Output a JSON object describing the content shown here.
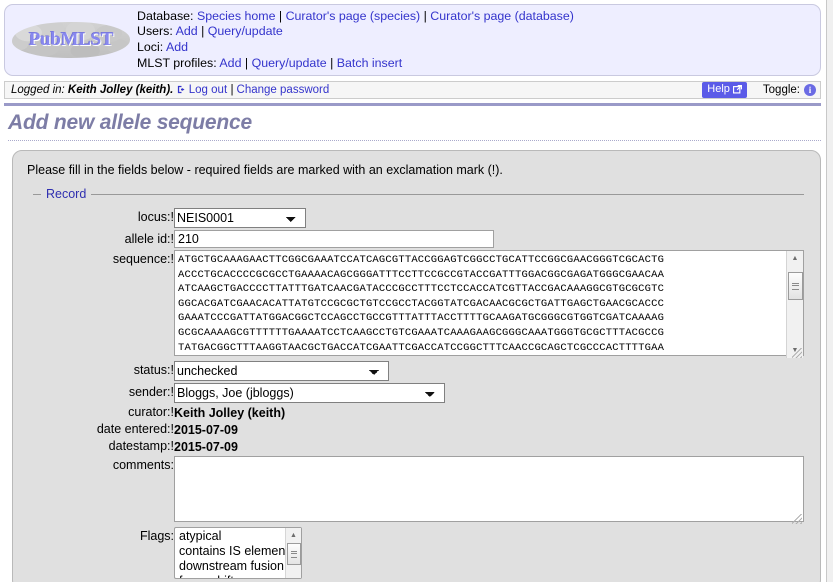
{
  "header": {
    "logo_text": "PubMLST",
    "nav": [
      {
        "label": "Database:",
        "links": [
          "Species home",
          "Curator's page (species)",
          "Curator's page (database)"
        ]
      },
      {
        "label": "Users:",
        "links": [
          "Add",
          "Query/update"
        ]
      },
      {
        "label": "Loci:",
        "links": [
          "Add"
        ]
      },
      {
        "label": "MLST profiles:",
        "links": [
          "Add",
          "Query/update",
          "Batch insert"
        ]
      }
    ]
  },
  "login_bar": {
    "prefix": "Logged in:",
    "user": "Keith Jolley (keith).",
    "logout": "Log out",
    "separator": "|",
    "change_password": "Change password",
    "help_label": "Help",
    "help_icon": "external-link-icon",
    "toggle_label": "Toggle:",
    "toggle_icon": "info-icon",
    "help_button_color": "#5b5be8"
  },
  "page": {
    "title": "Add new allele sequence",
    "title_color": "#7d7da6",
    "intro": "Please fill in the fields below - required fields are marked with an exclamation mark (!)."
  },
  "record": {
    "legend": "Record",
    "legend_color": "#2f2fb0",
    "fields": {
      "locus": {
        "label": "locus:!",
        "value": "NEIS0001",
        "options": [
          "NEIS0001"
        ]
      },
      "allele_id": {
        "label": "allele id:!",
        "value": "210",
        "placeholder": ""
      },
      "sequence": {
        "label": "sequence:!",
        "value": "ATGCTGCAAAGAACTTCGGCGAAATCCATCAGCGTTACCGGAGTCGGCCTGCATTCCGGCGAACGGGTCGCACTG\nACCCTGCACCCCGCGCCTGAAAACAGCGGGATTTCCTTCCGCCGTACCGATTTGGACGGCGAGATGGGCGAACAA\nATCAAGCTGACCCCTTATTTGATCAACGATACCCGCCTTTCCTCCACCATCGTTACCGACAAAGGCGTGCGCGTC\nGGCACGATCGAACACATTATGTCCGCGCTGTCCGCCTACGGTATCGACAACGCGCTGATTGAGCTGAACGCACCC\nGAAATCCCGATTATGGACGGCTCCAGCCTGCCGTTTATTTACCTTTTGCAAGATGCGGGCGTGGTCGATCAAAAG\nGCGCAAAAGCGTTTTTTGAAAATCCTCAAGCCTGTCGAAATCAAAGAAGCGGGCAAATGGGTGCGCTTTACGCCG\nTATGACGGCTTTAAGGTAACGCTGACCATCGAATTCGACCATCCGGCTTTCAACCGCAGCTCGCCCACTTTTGAA",
        "scrollbar": "vertical-scrollbar"
      },
      "status": {
        "label": "status:!",
        "value": "unchecked",
        "options": [
          "unchecked"
        ]
      },
      "sender": {
        "label": "sender:!",
        "value": "Bloggs, Joe (jbloggs)",
        "options": [
          "Bloggs, Joe (jbloggs)"
        ]
      },
      "curator": {
        "label": "curator:!",
        "value": "Keith Jolley (keith)"
      },
      "date_entered": {
        "label": "date entered:!",
        "value": "2015-07-09"
      },
      "datestamp": {
        "label": "datestamp:!",
        "value": "2015-07-09"
      },
      "comments": {
        "label": "comments:",
        "value": "",
        "placeholder": ""
      },
      "flags": {
        "label": "Flags:",
        "options": [
          "atypical",
          "contains IS element",
          "downstream fusion",
          "frameshift"
        ]
      }
    }
  }
}
